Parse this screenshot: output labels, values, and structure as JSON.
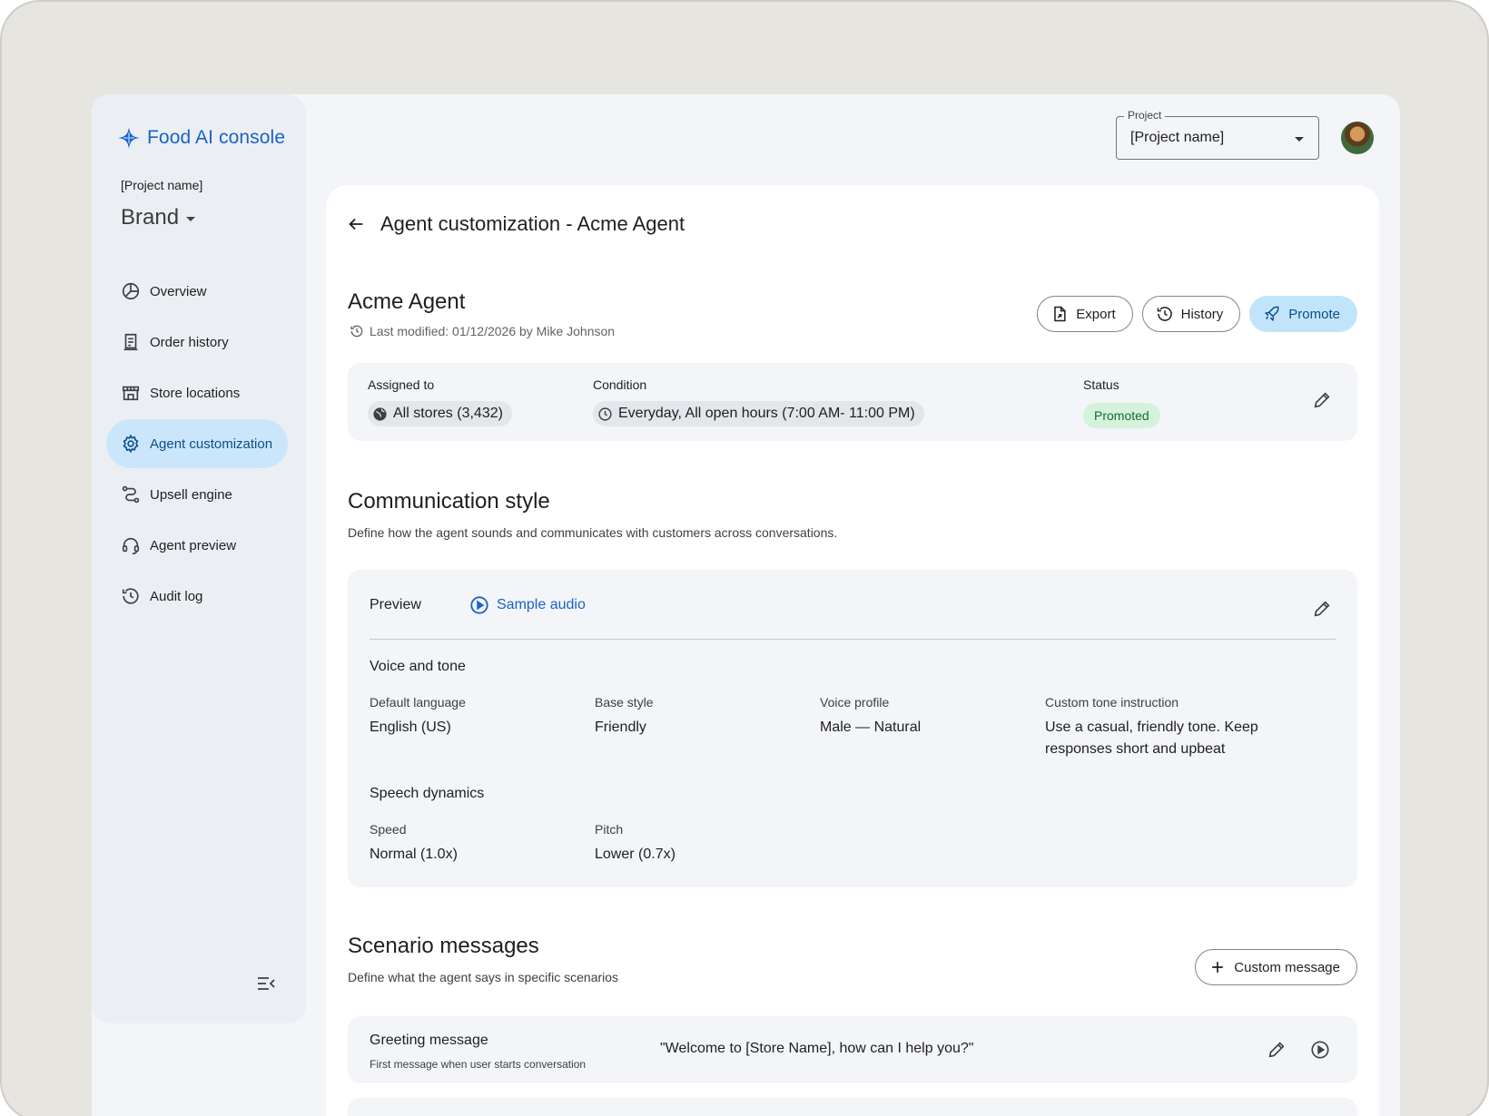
{
  "app": {
    "name": "Food AI console"
  },
  "sidebar": {
    "project_label": "[Project name]",
    "brand": "Brand",
    "items": [
      {
        "label": "Overview",
        "icon": "pie-chart-icon",
        "active": false
      },
      {
        "label": "Order history",
        "icon": "receipt-icon",
        "active": false
      },
      {
        "label": "Store locations",
        "icon": "store-icon",
        "active": false
      },
      {
        "label": "Agent customization",
        "icon": "gear-icon",
        "active": true
      },
      {
        "label": "Upsell engine",
        "icon": "route-icon",
        "active": false
      },
      {
        "label": "Agent preview",
        "icon": "headset-icon",
        "active": false
      },
      {
        "label": "Audit log",
        "icon": "history-icon",
        "active": false
      }
    ]
  },
  "topbar": {
    "project_field_label": "Project",
    "project_value": "[Project name]"
  },
  "page": {
    "title": "Agent customization - Acme Agent"
  },
  "agent": {
    "name": "Acme Agent",
    "last_modified": "Last modified: 01/12/2026 by Mike Johnson",
    "actions": {
      "export": "Export",
      "history": "History",
      "promote": "Promote"
    },
    "assigned_label": "Assigned to",
    "assigned_value": "All stores (3,432)",
    "condition_label": "Condition",
    "condition_value": "Everyday, All open hours (7:00 AM- 11:00 PM)",
    "status_label": "Status",
    "status_value": "Promoted",
    "status_color": "#d5f2dc"
  },
  "communication": {
    "title": "Communication style",
    "description": "Define how the agent sounds and communicates with customers across conversations.",
    "preview_label": "Preview",
    "sample_audio": "Sample audio",
    "voice_heading": "Voice and tone",
    "default_language_label": "Default language",
    "default_language": "English (US)",
    "base_style_label": "Base style",
    "base_style": "Friendly",
    "voice_profile_label": "Voice profile",
    "voice_profile": "Male — Natural",
    "custom_tone_label": "Custom tone instruction",
    "custom_tone": "Use a casual, friendly tone. Keep responses short and upbeat",
    "speech_heading": "Speech dynamics",
    "speed_label": "Speed",
    "speed": "Normal (1.0x)",
    "pitch_label": "Pitch",
    "pitch": "Lower (0.7x)"
  },
  "scenarios": {
    "title": "Scenario messages",
    "description": "Define what the agent says in specific scenarios",
    "custom_button": "Custom message",
    "greeting_title": "Greeting message",
    "greeting_sub": "First message when user starts conversation",
    "greeting_message": "\"Welcome to [Store Name], how can I help you?\""
  },
  "colors": {
    "accent": "#1a63c7",
    "active_nav": "#cbe6fb",
    "primary_button": "#c2e4fb"
  }
}
